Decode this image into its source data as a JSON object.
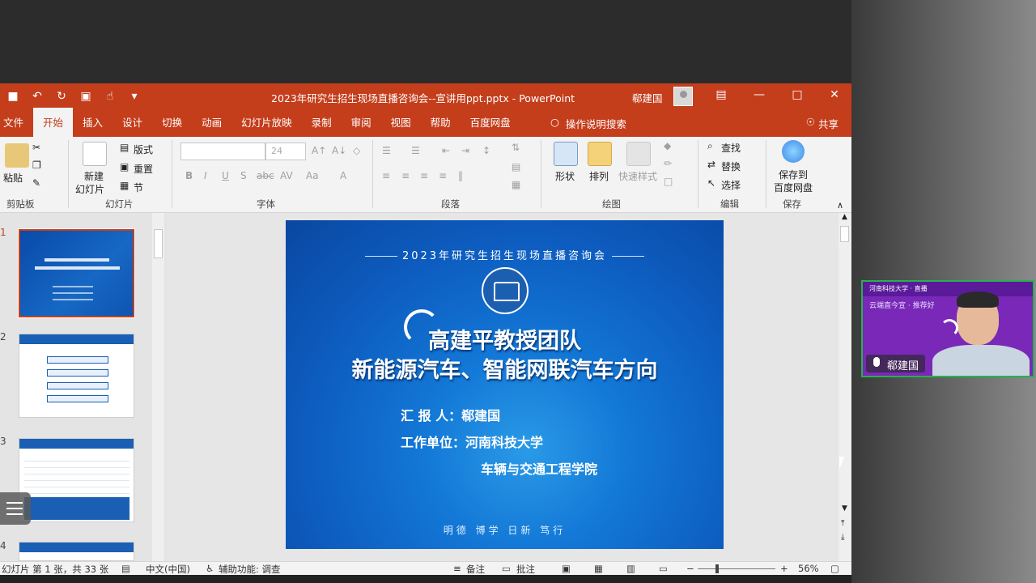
{
  "titlebar": {
    "doc_title": "2023年研究生招生现场直播咨询会--宣讲用ppt.pptx  -  PowerPoint",
    "user_name": "郗建国"
  },
  "tabs": [
    "文件",
    "开始",
    "插入",
    "设计",
    "切换",
    "动画",
    "幻灯片放映",
    "录制",
    "审阅",
    "视图",
    "帮助",
    "百度网盘"
  ],
  "tellme": "操作说明搜索",
  "share": "共享",
  "ribbon": {
    "clipboard": {
      "paste": "粘贴",
      "label": "剪贴板"
    },
    "slides": {
      "new_line1": "新建",
      "new_line2": "幻灯片",
      "layout": "版式",
      "reset": "重置",
      "section": "节",
      "label": "幻灯片"
    },
    "font": {
      "size": "24",
      "label": "字体"
    },
    "paragraph": {
      "label": "段落"
    },
    "drawing": {
      "shapes": "形状",
      "arrange": "排列",
      "quick_styles": "快速样式",
      "label": "绘图"
    },
    "editing": {
      "find": "查找",
      "replace": "替换",
      "select": "选择",
      "label": "编辑"
    },
    "save": {
      "line1": "保存到",
      "line2": "百度网盘",
      "label": "保存"
    }
  },
  "thumbnails": [
    "1",
    "2",
    "3",
    "4"
  ],
  "slide": {
    "top_line": "2023年研究生招生现场直播咨询会",
    "title1": "高建平教授团队",
    "title2": "新能源汽车、智能网联汽车方向",
    "reporter": "汇 报 人：郗建国",
    "unit": "工作单位：河南科技大学",
    "college": "车辆与交通工程学院",
    "motto": "明德 博学 日新 笃行"
  },
  "status": {
    "slide_count": "幻灯片 第 1 张，共 33 张",
    "language": "中文(中国)",
    "accessibility": "辅助功能: 调查",
    "notes": "备注",
    "comments": "批注",
    "zoom": "56%"
  },
  "camera": {
    "name": "郗建国",
    "band_text": "河南科技大学 · 直播",
    "line_text": "云端直今宣 · 推荐好"
  }
}
